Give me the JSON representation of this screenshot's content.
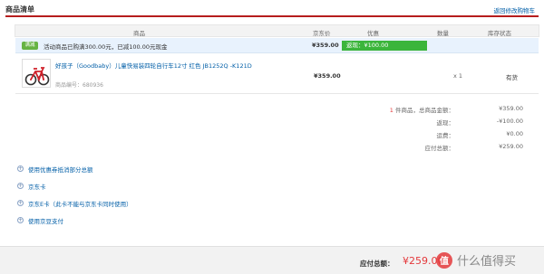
{
  "header": {
    "title": "商品清单",
    "back_link": "返回修改购物车"
  },
  "columns": [
    "商品",
    "京东价",
    "优惠",
    "数量",
    "库存状态"
  ],
  "promo": {
    "badge": "满减",
    "text": "活动商品已购满300.00元，已减100.00元现金",
    "price": "¥359.00",
    "coupon": "返现：¥100.00"
  },
  "item": {
    "name": "好孩子（Goodbaby）儿童快易装四轮自行车12寸 红色 JB1252Q -K121D",
    "sku": "商品编号：680936",
    "price": "¥359.00",
    "qty": "x 1",
    "stock": "有货"
  },
  "summary": {
    "count_label": "1 件商品，总商品金额：",
    "count_num": "1",
    "count_suffix": " 件商品，总商品金额：",
    "total_goods": "¥359.00",
    "cashback_label": "返现：",
    "cashback": "-¥100.00",
    "freight_label": "运费：",
    "freight": "¥0.00",
    "payable_label": "应付总额：",
    "payable": "¥259.00"
  },
  "options": [
    "使用优惠券抵消部分总额",
    "京东卡",
    "京东E卡（此卡不能与京东卡同时使用）",
    "使用京豆支付"
  ],
  "footer": {
    "label": "应付总额：",
    "total": "¥259.00"
  },
  "watermark": "什么值得买",
  "colors": {
    "accent_red": "#e4393c",
    "link_blue": "#005ea7",
    "coupon_green": "#3bb53b"
  }
}
